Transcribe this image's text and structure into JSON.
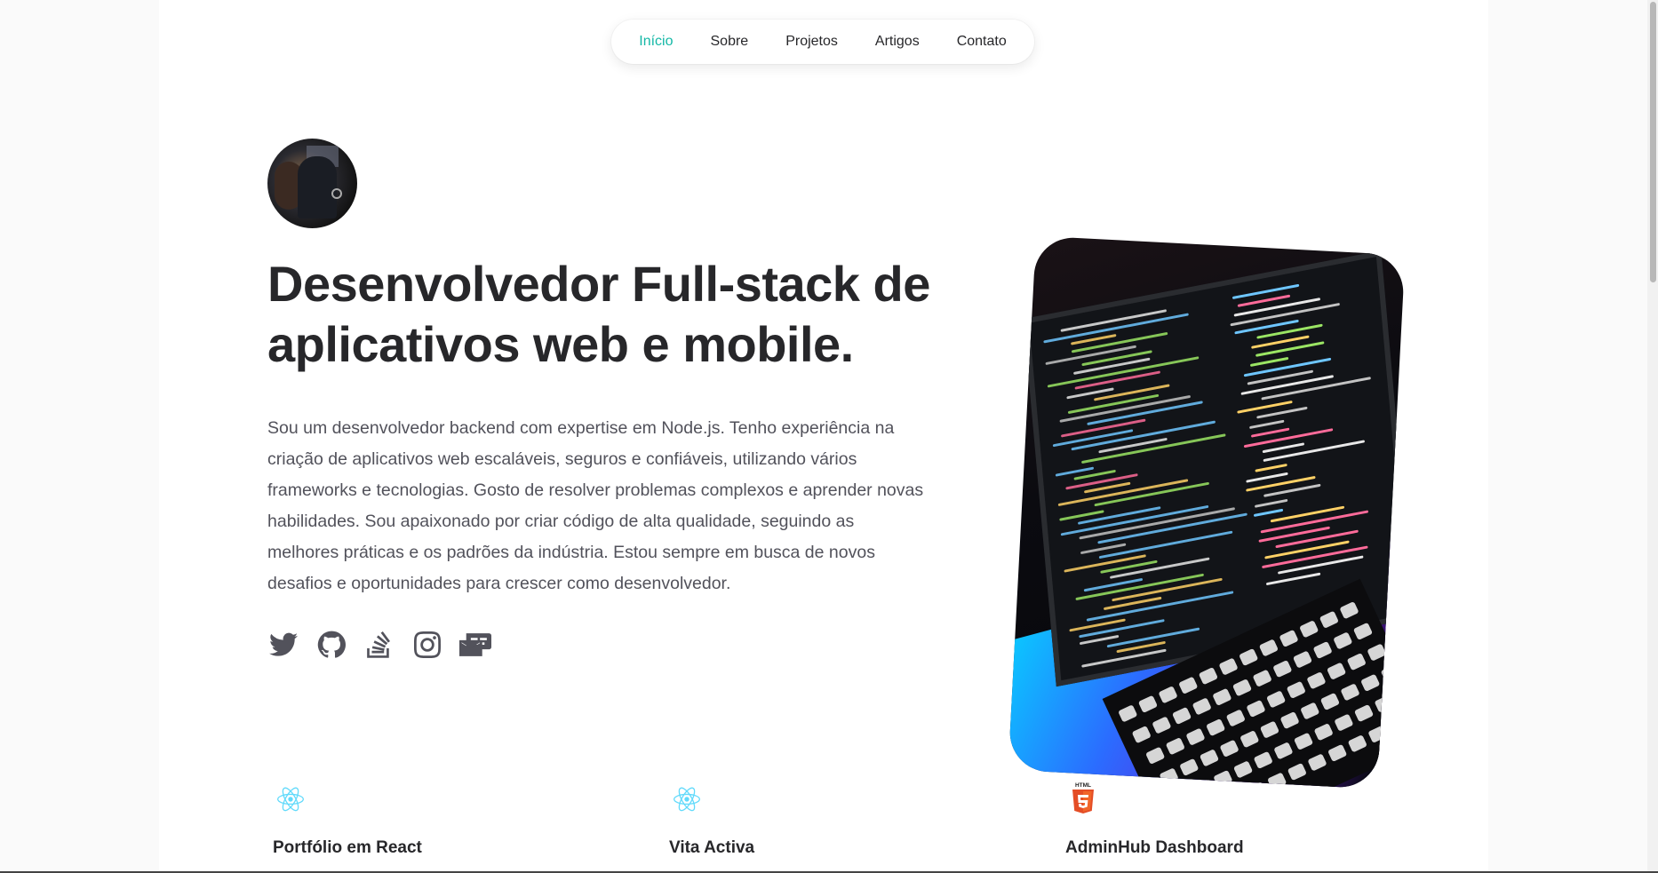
{
  "nav": {
    "items": [
      {
        "label": "Início",
        "active": true
      },
      {
        "label": "Sobre",
        "active": false
      },
      {
        "label": "Projetos",
        "active": false
      },
      {
        "label": "Artigos",
        "active": false
      },
      {
        "label": "Contato",
        "active": false
      }
    ],
    "active_color": "#14b8a6"
  },
  "hero": {
    "headline": "Desenvolvedor Full-stack de aplicativos web e mobile.",
    "bio": "Sou um desenvolvedor backend com expertise em Node.js. Tenho experiência na criação de aplicativos web escaláveis, seguros e confiáveis, utilizando vários frameworks e tecnologias. Gosto de resolver problemas complexos e aprender novas habilidades. Sou apaixonado por criar código de alta qualidade, seguindo as melhores práticas e os padrões da indústria. Estou sempre em busca de novos desafios e oportunidades para crescer como desenvolvedor."
  },
  "socials": [
    {
      "icon": "twitter-icon"
    },
    {
      "icon": "github-icon"
    },
    {
      "icon": "stackoverflow-icon"
    },
    {
      "icon": "instagram-icon"
    },
    {
      "icon": "mail-card-icon"
    }
  ],
  "projects": [
    {
      "title": "Portfólio em React",
      "icon": "react-icon"
    },
    {
      "title": "Vita Activa",
      "icon": "react-icon"
    },
    {
      "title": "AdminHub Dashboard",
      "icon": "html5-icon"
    }
  ],
  "colors": {
    "text": "#27272a",
    "muted": "#52525b",
    "react": "#61dafb",
    "html5": "#e44d26"
  }
}
